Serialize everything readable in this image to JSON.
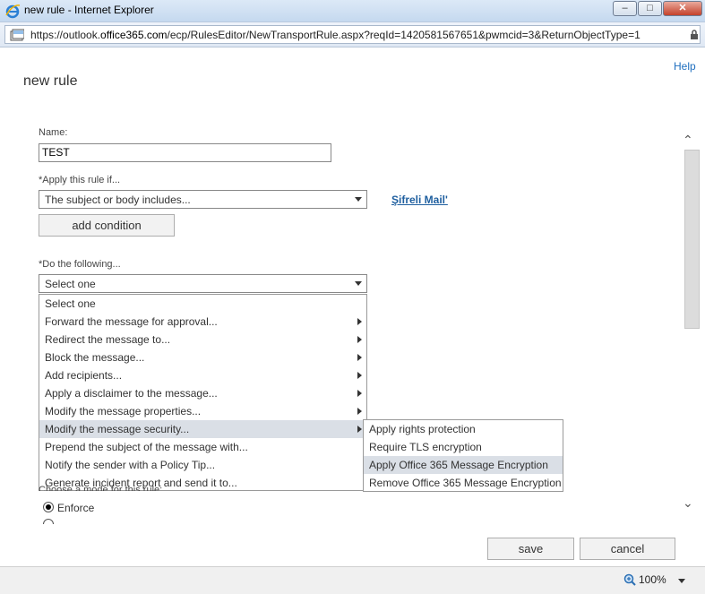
{
  "window": {
    "title": "new rule - Internet Explorer",
    "minimize": "–",
    "maximize": "□",
    "close": "✕"
  },
  "address": {
    "url_prefix": "https://outlook.",
    "url_domain": "office365.com",
    "url_suffix": "/ecp/RulesEditor/NewTransportRule.aspx?reqId=1420581567651&pwmcid=3&ReturnObjectType=1"
  },
  "help": "Help",
  "page_title": "new rule",
  "name_label": "Name:",
  "name_value": "TEST",
  "apply_label": "*Apply this rule if...",
  "apply_value": "The subject or body includes...",
  "apply_link": "Şifreli Mail'",
  "add_condition": "add condition",
  "do_label": "*Do the following...",
  "do_value": "Select one",
  "dropdown_items": [
    {
      "label": "Select one",
      "submenu": false
    },
    {
      "label": "Forward the message for approval...",
      "submenu": true
    },
    {
      "label": "Redirect the message to...",
      "submenu": true
    },
    {
      "label": "Block the message...",
      "submenu": true
    },
    {
      "label": "Add recipients...",
      "submenu": true
    },
    {
      "label": "Apply a disclaimer to the message...",
      "submenu": true
    },
    {
      "label": "Modify the message properties...",
      "submenu": true
    },
    {
      "label": "Modify the message security...",
      "submenu": true
    },
    {
      "label": "Prepend the subject of the message with...",
      "submenu": false
    },
    {
      "label": "Notify the sender with a Policy Tip...",
      "submenu": false
    },
    {
      "label": "Generate incident report and send it to...",
      "submenu": false
    }
  ],
  "highlighted_item": 7,
  "submenu_items": [
    "Apply rights protection",
    "Require TLS encryption",
    "Apply Office 365 Message Encryption",
    "Remove Office 365 Message Encryption"
  ],
  "submenu_highlighted": 2,
  "mode_label_partial": "Choose a mode for this rule:",
  "enforce_label": "Enforce",
  "save": "save",
  "cancel": "cancel",
  "zoom": "100%"
}
